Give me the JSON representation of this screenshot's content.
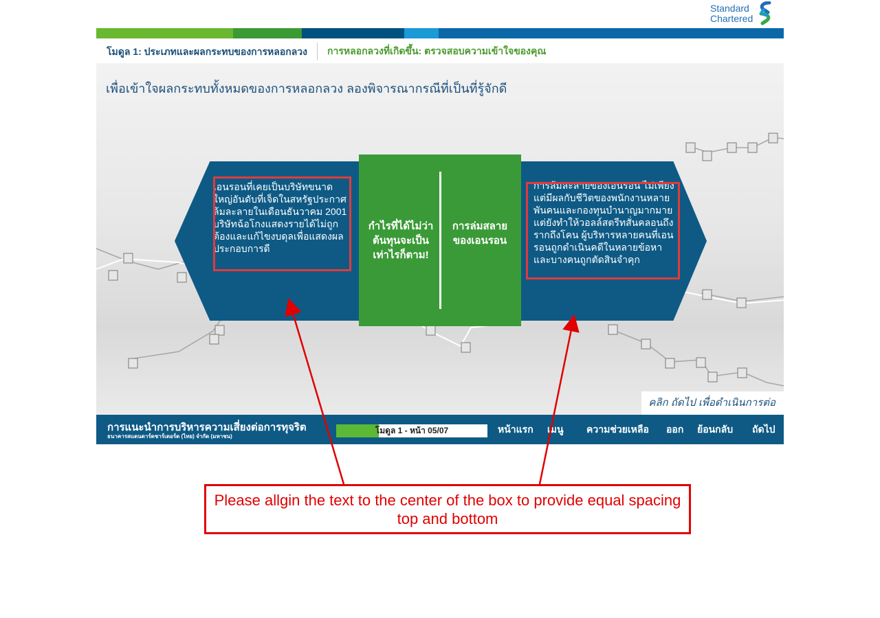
{
  "logo": {
    "line1": "Standard",
    "line2": "Chartered",
    "icon": "standard-chartered-logo"
  },
  "stripe_colors": [
    "#69b830",
    "#3c9a35",
    "#00517f",
    "#1a9ad6",
    "#0b68a8"
  ],
  "breadcrumb": {
    "module": "โมดูล 1: ประเภทและผลกระทบของการหลอกลวง",
    "page": "การหลอกลวงที่เกิดขึ้น: ตรวจสอบความเข้าใจของคุณ"
  },
  "stage": {
    "title": "เพื่อเข้าใจผลกระทบทั้งหมดของการหลอกลวง ลองพิจารณากรณีที่เป็นที่รู้จักดี",
    "left_panel": "เอนรอนที่เคยเป็นบริษัทขนาดใหญ่อันดับที่เจ็ดในสหรัฐประกาศล้มละลายในเดือนธันวาคม 2001 บริษัทฉ้อโกงแสดงรายได้ไม่ถูกต้องและแก้ไขงบดุลเพื่อแสดงผลประกอบการดี",
    "center_left": "กำไรที่ได้ไม่ว่าต้นทุนจะเป็นเท่าไรก็ตาม!",
    "center_right": "การล่มสลายของเอนรอน",
    "right_panel": "การล้มละลายของเอนรอน ไม่เพียงแต่มีผลกับชีวิตของพนักงานหลายพันคนและกองทุนบำนาญมากมาย แต่ยังทำให้วอลล์สตรีทสั่นคลอนถึงรากถึงโคน ผู้บริหารหลายคนที่เอนรอนถูกดำเนินคดีในหลายข้อหาและบางคนถูกตัดสินจำคุก",
    "prompt": "คลิก ถัดไป เพื่อดำเนินการต่อ",
    "panel_color": "#0e5a85",
    "center_color": "#3a9a37"
  },
  "bottom_bar": {
    "course_title": "การแนะนำการบริหารความเสี่ยงต่อการทุจริต",
    "course_subtitle": "ธนาคารสแตนดาร์ดชาร์เตอร์ด (ไทย) จำกัด (มหาชน)",
    "progress_label": "โมดูล 1 - หน้า 05/07",
    "progress": 0.28,
    "nav": {
      "home": "หน้าแรก",
      "menu": "เมนู",
      "help": "ความช่วยเหลือ",
      "exit": "ออก",
      "back": "ย้อนกลับ",
      "next": "ถัดไป"
    }
  },
  "feedback": {
    "text": "Please allgin the text to the center of the box to provide equal spacing top and bottom",
    "color": "#e00000"
  }
}
